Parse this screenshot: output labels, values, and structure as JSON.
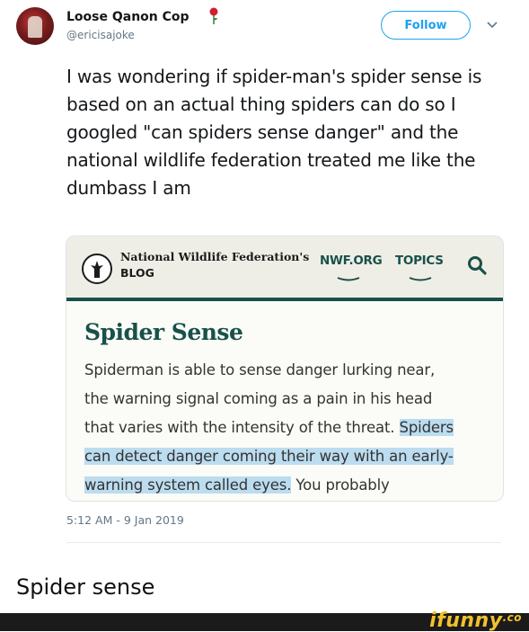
{
  "tweet": {
    "author_name": "Loose Qanon Cop",
    "author_handle": "@ericisajoke",
    "follow_label": "Follow",
    "text": "I was wondering if spider-man's spider sense is based on an actual thing spiders can do so I googled \"can spiders sense danger\" and the national wildlife federation treated me like the dumbass I am",
    "timestamp": "5:12 AM - 9 Jan 2019",
    "accent_color": "#1da1f2"
  },
  "embedded_screenshot": {
    "org_title": "National Wildlife Federation's",
    "blog_label": "BLOG",
    "nav": [
      "NWF.ORG",
      "TOPICS"
    ],
    "heading": "Spider Sense",
    "lines": [
      {
        "plain": "Spiderman is able to sense danger lurking near,"
      },
      {
        "plain": "the warning signal coming as a pain in his head"
      },
      {
        "plain": "that varies with the intensity of the threat. ",
        "highlight": "Spiders"
      },
      {
        "highlight": "can detect danger coming their way with an early-"
      },
      {
        "highlight": "warning system called eyes.",
        "plain_after": " You probably"
      }
    ],
    "brand_color": "#18514a",
    "highlight_color": "#bcdcef"
  },
  "caption": "Spider sense",
  "watermark": {
    "text": "ifunny",
    "suffix": ".co"
  }
}
